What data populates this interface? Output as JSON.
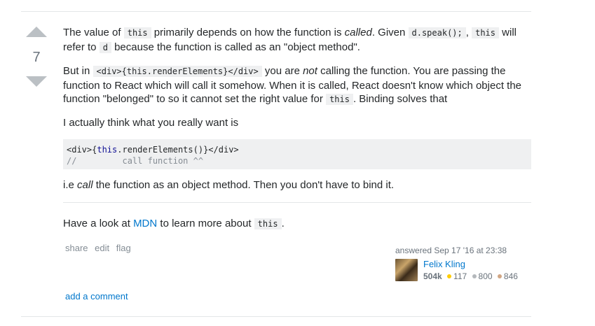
{
  "vote": {
    "count": "7"
  },
  "post": {
    "p1": {
      "t1": "The value of ",
      "c1": "this",
      "t2": " primarily depends on how the function is ",
      "em1": "called",
      "t3": ". Given ",
      "c2": "d.speak();",
      "t4": ", ",
      "c3": "this",
      "t5": " will refer to ",
      "c4": "d",
      "t6": " because the function is called as an \"object method\"."
    },
    "p2": {
      "t1": "But in ",
      "c1": "<div>{this.renderElements}</div>",
      "t2": " you are ",
      "em1": "not",
      "t3": " calling the function. You are passing the function to React which will call it somehow. When it is called, React doesn't know which object the function \"belonged\" to so it cannot set the right value for ",
      "c2": "this",
      "t4": ". Binding solves that"
    },
    "p3": "I actually think what you really want is",
    "code": {
      "line1_a": "<div>{",
      "line1_kw": "this",
      "line1_b": ".renderElements()}</div>",
      "line2": "//         call function ^^"
    },
    "p4": {
      "t1": "i.e ",
      "em1": "call",
      "t2": " the function as an object method. Then you don't have to bind it."
    },
    "p5": {
      "t1": "Have a look at ",
      "link": "MDN",
      "t2": " to learn more about ",
      "c1": "this",
      "t3": "."
    }
  },
  "menu": {
    "share": "share",
    "edit": "edit",
    "flag": "flag"
  },
  "signature": {
    "action": "answered",
    "time": "Sep 17 '16 at 23:38",
    "user": "Felix Kling",
    "reputation": "504k",
    "gold": "117",
    "silver": "800",
    "bronze": "846"
  },
  "add_comment": "add a comment"
}
